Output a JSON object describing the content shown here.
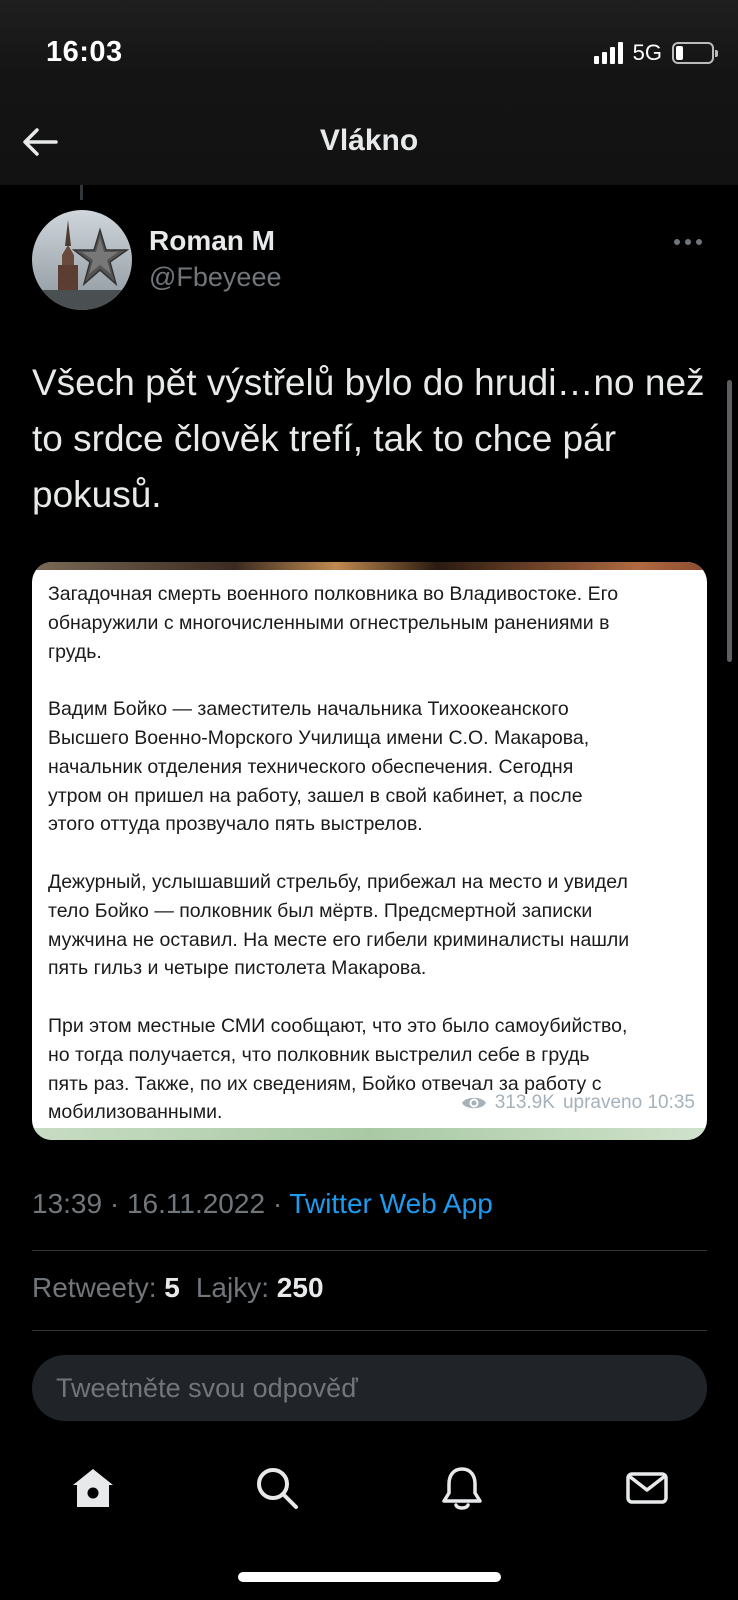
{
  "status_bar": {
    "time": "16:03",
    "network": "5G",
    "battery_level": 0.22
  },
  "header": {
    "title": "Vlákno"
  },
  "tweet": {
    "author_name": "Roman M",
    "author_handle": "@Fbeyeee",
    "text": "Všech pět výstřelů bylo do hrudi…no než to srdce člověk trefí, tak to chce pár pokusů.",
    "media": {
      "paragraphs": [
        "Загадочная смерть военного полковника во Владивостоке. Его\nобнаружили с многочисленными огнестрельным ранениями в\nгрудь.",
        "Вадим Бойко — заместитель начальника Тихоокеанского\nВысшего Военно-Морского Училища имени С.О. Макарова,\nначальник отделения технического обеспечения. Сегодня\nутром он пришел на работу, зашел в свой кабинет, а после\nэтого оттуда прозвучало пять выстрелов.",
        "Дежурный, услышавший стрельбу, прибежал на место и увидел\nтело Бойко —  полковник был мёртв. Предсмертной записки\nмужчина не оставил. На месте его гибели криминалисты нашли\nпять гильз и четыре пистолета Макарова.",
        "При этом местные СМИ сообщают, что это было самоубийство,\nно тогда получается, что полковник выстрелил себе в грудь\nпять раз. Также, по их сведениям, Бойко отвечал за работу с\nмобилизованными."
      ],
      "views": "313.9K",
      "edited": "upraveno 10:35"
    },
    "time": "13:39",
    "date": "16.11.2022",
    "source": "Twitter Web App",
    "retweets_label": "Retweety:",
    "retweets": "5",
    "likes_label": "Lajky:",
    "likes": "250"
  },
  "reply": {
    "placeholder": "Tweetněte svou odpověď"
  },
  "tabs": [
    "home-icon",
    "search-icon",
    "notifications-icon",
    "messages-icon"
  ]
}
